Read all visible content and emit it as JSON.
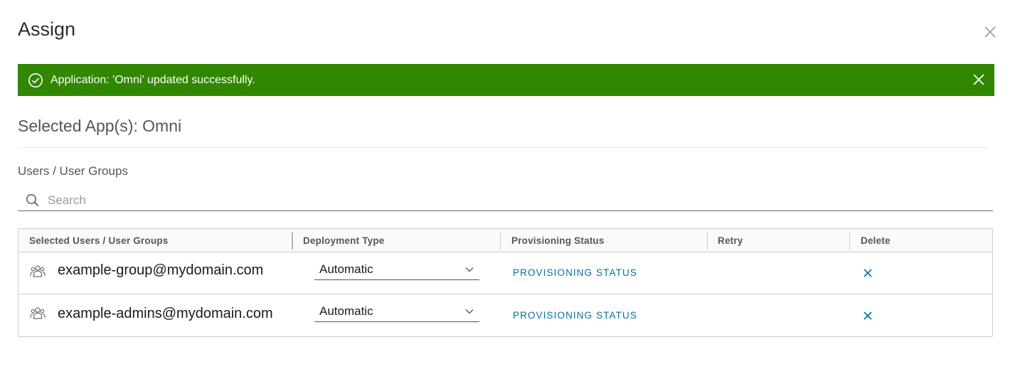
{
  "modal": {
    "title": "Assign",
    "close_icon": "close-icon"
  },
  "alert": {
    "message": "Application: 'Omni' updated successfully.",
    "icon": "check-circle-icon",
    "close_icon": "close-icon",
    "background_color": "#318700"
  },
  "selected_apps": {
    "label": "Selected App(s): Omni"
  },
  "users_section": {
    "label": "Users / User Groups",
    "search": {
      "placeholder": "Search",
      "value": ""
    }
  },
  "table": {
    "columns": [
      "Selected Users / User Groups",
      "Deployment Type",
      "Provisioning Status",
      "Retry",
      "Delete"
    ],
    "rows": [
      {
        "name": "example-group@mydomain.com",
        "icon": "user-group-icon",
        "deployment_type": "Automatic",
        "provisioning_status": "PROVISIONING STATUS",
        "retry": "",
        "delete_icon": "close-icon"
      },
      {
        "name": "example-admins@mydomain.com",
        "icon": "user-group-icon",
        "deployment_type": "Automatic",
        "provisioning_status": "PROVISIONING STATUS",
        "retry": "",
        "delete_icon": "close-icon"
      }
    ]
  },
  "colors": {
    "link": "#0072a3",
    "success": "#318700"
  }
}
